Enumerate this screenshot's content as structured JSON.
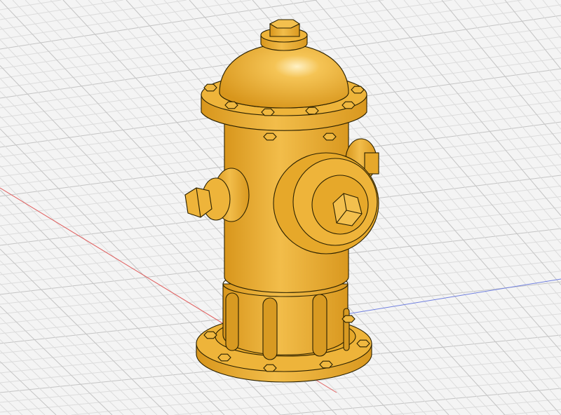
{
  "viewport": {
    "model": "fire-hydrant",
    "colors": {
      "background": "#f4f4f4",
      "grid_minor": "#dcdcdc",
      "grid_major": "#c4c4c4",
      "x_axis": "#e06060",
      "z_axis": "#7080e0",
      "body": "#e9ab2e",
      "body_light": "#f5c455",
      "body_dark": "#c98a12",
      "outline": "#2a2000"
    }
  }
}
